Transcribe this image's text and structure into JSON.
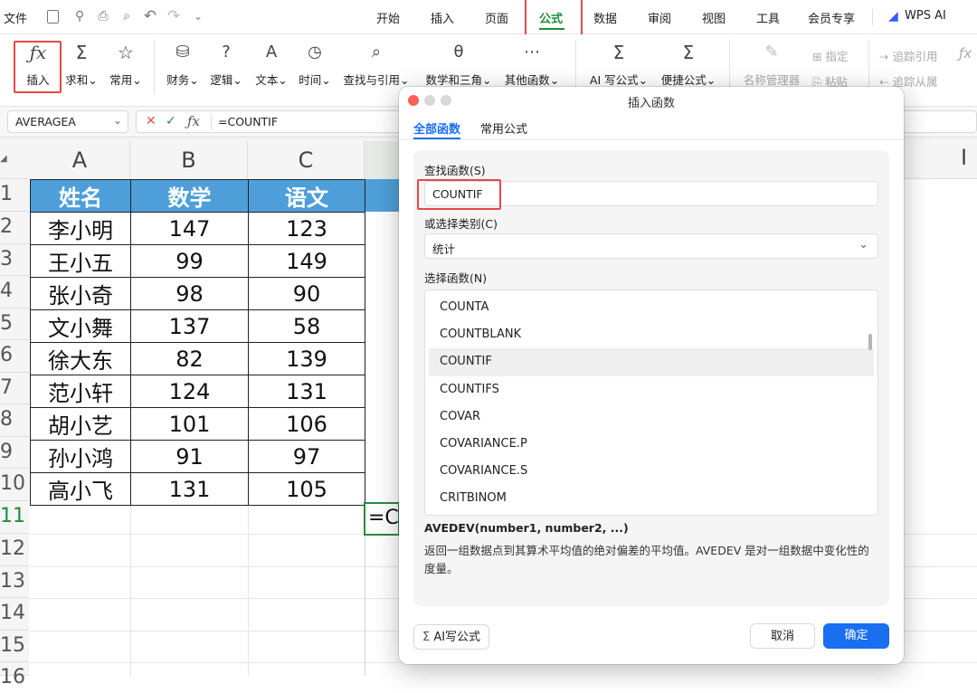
{
  "menubar": {
    "file": "文件",
    "tabs": [
      "开始",
      "插入",
      "页面",
      "公式",
      "数据",
      "审阅",
      "视图",
      "工具",
      "会员专享"
    ],
    "active_tab": "公式",
    "wps_ai": "WPS AI"
  },
  "ribbon": {
    "insert_label": "插入",
    "sum_label": "求和",
    "common_label": "常用",
    "finance_label": "财务",
    "logic_label": "逻辑",
    "text_label": "文本",
    "time_label": "时间",
    "lookup_label": "查找与引用",
    "math_label": "数学和三角",
    "other_label": "其他函数",
    "ai_formula_label": "AI 写公式",
    "quick_formula_label": "便捷公式",
    "name_manager_label": "名称管理器",
    "assign_label": "指定",
    "paste_label": "粘贴",
    "trace_precedents_label": "追踪引用",
    "trace_dependents_label": "追踪从属"
  },
  "formula_bar": {
    "name_box": "AVERAGEA",
    "formula": "=COUNTIF"
  },
  "sheet": {
    "columns": [
      "A",
      "B",
      "C"
    ],
    "row_numbers": [
      "1",
      "2",
      "3",
      "4",
      "5",
      "6",
      "7",
      "8",
      "9",
      "10",
      "11",
      "12",
      "13",
      "14",
      "15",
      "16"
    ],
    "header": [
      "姓名",
      "数学",
      "语文"
    ],
    "rows": [
      [
        "李小明",
        "147",
        "123"
      ],
      [
        "王小五",
        "99",
        "149"
      ],
      [
        "张小奇",
        "98",
        "90"
      ],
      [
        "文小舞",
        "137",
        "58"
      ],
      [
        "徐大东",
        "82",
        "139"
      ],
      [
        "范小轩",
        "124",
        "131"
      ],
      [
        "胡小艺",
        "101",
        "106"
      ],
      [
        "孙小鸿",
        "91",
        "97"
      ],
      [
        "高小飞",
        "131",
        "105"
      ]
    ],
    "active_cell_text": "=CO"
  },
  "dialog": {
    "title": "插入函数",
    "tabs": [
      "全部函数",
      "常用公式"
    ],
    "search_label": "查找函数(S)",
    "search_value": "COUNTIF",
    "category_label": "或选择类别(C)",
    "category_value": "统计",
    "function_list_label": "选择函数(N)",
    "functions": [
      "COUNTA",
      "COUNTBLANK",
      "COUNTIF",
      "COUNTIFS",
      "COVAR",
      "COVARIANCE.P",
      "COVARIANCE.S",
      "CRITBINOM"
    ],
    "selected_function": "COUNTIF",
    "signature": "AVEDEV(number1, number2, ...)",
    "description": "返回一组数据点到其算术平均值的绝对偏差的平均值。AVEDEV 是对一组数据中变化性的度量。",
    "ai_button": "AI写公式",
    "cancel": "取消",
    "ok": "确定"
  },
  "colors": {
    "accent": "#1a6ef0",
    "active_tab": "#1f8f3a",
    "highlight_box": "#e8484b",
    "table_header": "#4e9fd9"
  }
}
